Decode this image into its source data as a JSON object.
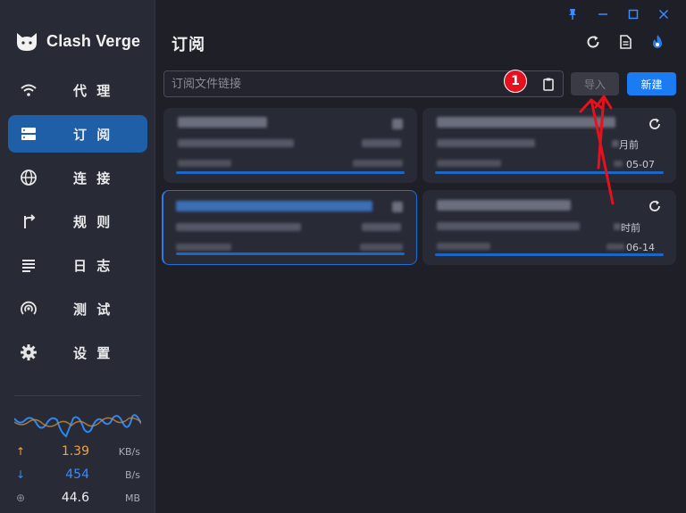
{
  "app": {
    "name": "Clash Verge"
  },
  "sidebar": {
    "items": [
      {
        "label": "代 理",
        "icon": "wifi-icon"
      },
      {
        "label": "订 阅",
        "icon": "storage-icon",
        "active": true
      },
      {
        "label": "连 接",
        "icon": "globe-icon"
      },
      {
        "label": "规 则",
        "icon": "fork-icon"
      },
      {
        "label": "日 志",
        "icon": "list-icon"
      },
      {
        "label": "测 试",
        "icon": "radar-icon"
      },
      {
        "label": "设 置",
        "icon": "gear-icon"
      }
    ],
    "traffic": {
      "upload": {
        "value": "1.39",
        "unit": "KB/s",
        "icon": "↑",
        "color": "#f2a33a"
      },
      "download": {
        "value": "454",
        "unit": "B/s",
        "icon": "↓",
        "color": "#3a8bff"
      },
      "memory": {
        "value": "44.6",
        "unit": "MB",
        "icon": "⊕",
        "color": "#8a8c96"
      }
    }
  },
  "header": {
    "title": "订阅"
  },
  "toolbar": {
    "url_placeholder": "订阅文件链接",
    "import_label": "导入",
    "new_label": "新建",
    "badge": "1"
  },
  "cards": [
    {
      "updated": "",
      "date": ""
    },
    {
      "updated": "月前",
      "date": "05-07"
    },
    {
      "updated": "",
      "date": ""
    },
    {
      "updated": "时前",
      "date": "06-14"
    }
  ],
  "colors": {
    "accent": "#1a7bf2",
    "active_nav": "#1f5fa8",
    "annotation": "#e5121e"
  }
}
